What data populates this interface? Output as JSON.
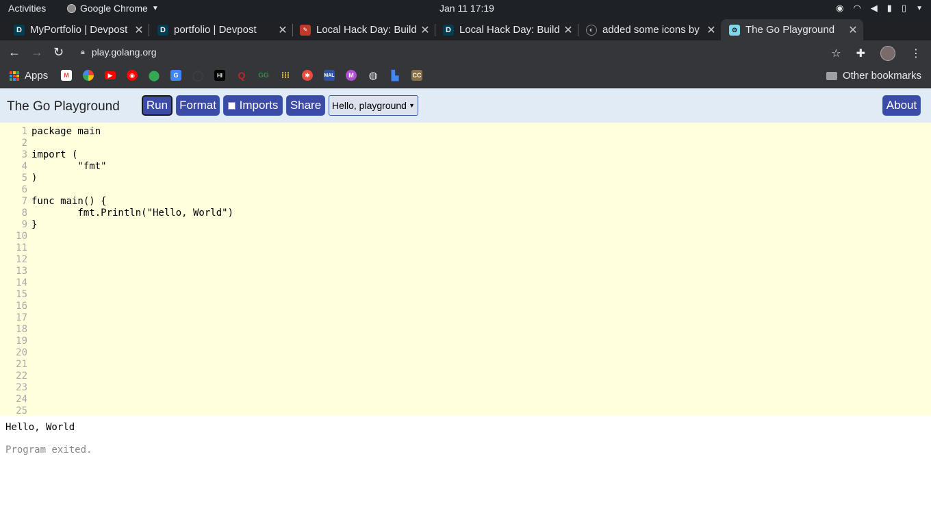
{
  "system": {
    "activities": "Activities",
    "app_name": "Google Chrome",
    "clock": "Jan 11  17:19"
  },
  "tabs": [
    {
      "title": "MyPortfolio | Devpost",
      "favicon": "D"
    },
    {
      "title": "portfolio | Devpost",
      "favicon": "D"
    },
    {
      "title": "Local Hack Day: Build",
      "favicon": "mlh"
    },
    {
      "title": "Local Hack Day: Build",
      "favicon": "D"
    },
    {
      "title": "added some icons by",
      "favicon": "github"
    },
    {
      "title": "The Go Playground",
      "favicon": "gopher"
    }
  ],
  "toolbar": {
    "url": "play.golang.org"
  },
  "bookmarks": {
    "apps_label": "Apps",
    "other_label": "Other bookmarks",
    "icons": [
      "gmail-icon",
      "photos-icon",
      "youtube-icon",
      "youtube-music-icon",
      "maps-icon",
      "translate-icon",
      "github-icon",
      "hackerrank-icon",
      "quora-icon",
      "geeksforgeeks-icon",
      "grid-icon",
      "codechef-icon",
      "mal-icon",
      "medium-icon",
      "globe-icon",
      "chart-icon",
      "cc-icon"
    ]
  },
  "playground": {
    "title": "The Go Playground",
    "run": "Run",
    "format": "Format",
    "imports": "Imports",
    "share": "Share",
    "example_select": "Hello, playground",
    "about": "About"
  },
  "editor": {
    "code_lines": [
      "package main",
      "",
      "import (",
      "\t\"fmt\"",
      ")",
      "",
      "func main() {",
      "\tfmt.Println(\"Hello, World\")",
      "}"
    ],
    "line_numbers": [
      "1",
      "2",
      "3",
      "4",
      "5",
      "6",
      "7",
      "8",
      "9",
      "10",
      "11",
      "12",
      "13",
      "14",
      "15",
      "16",
      "17",
      "18",
      "19",
      "20",
      "21",
      "22",
      "23",
      "24",
      "25"
    ]
  },
  "output": {
    "stdout": "Hello, World",
    "status": "Program exited."
  }
}
